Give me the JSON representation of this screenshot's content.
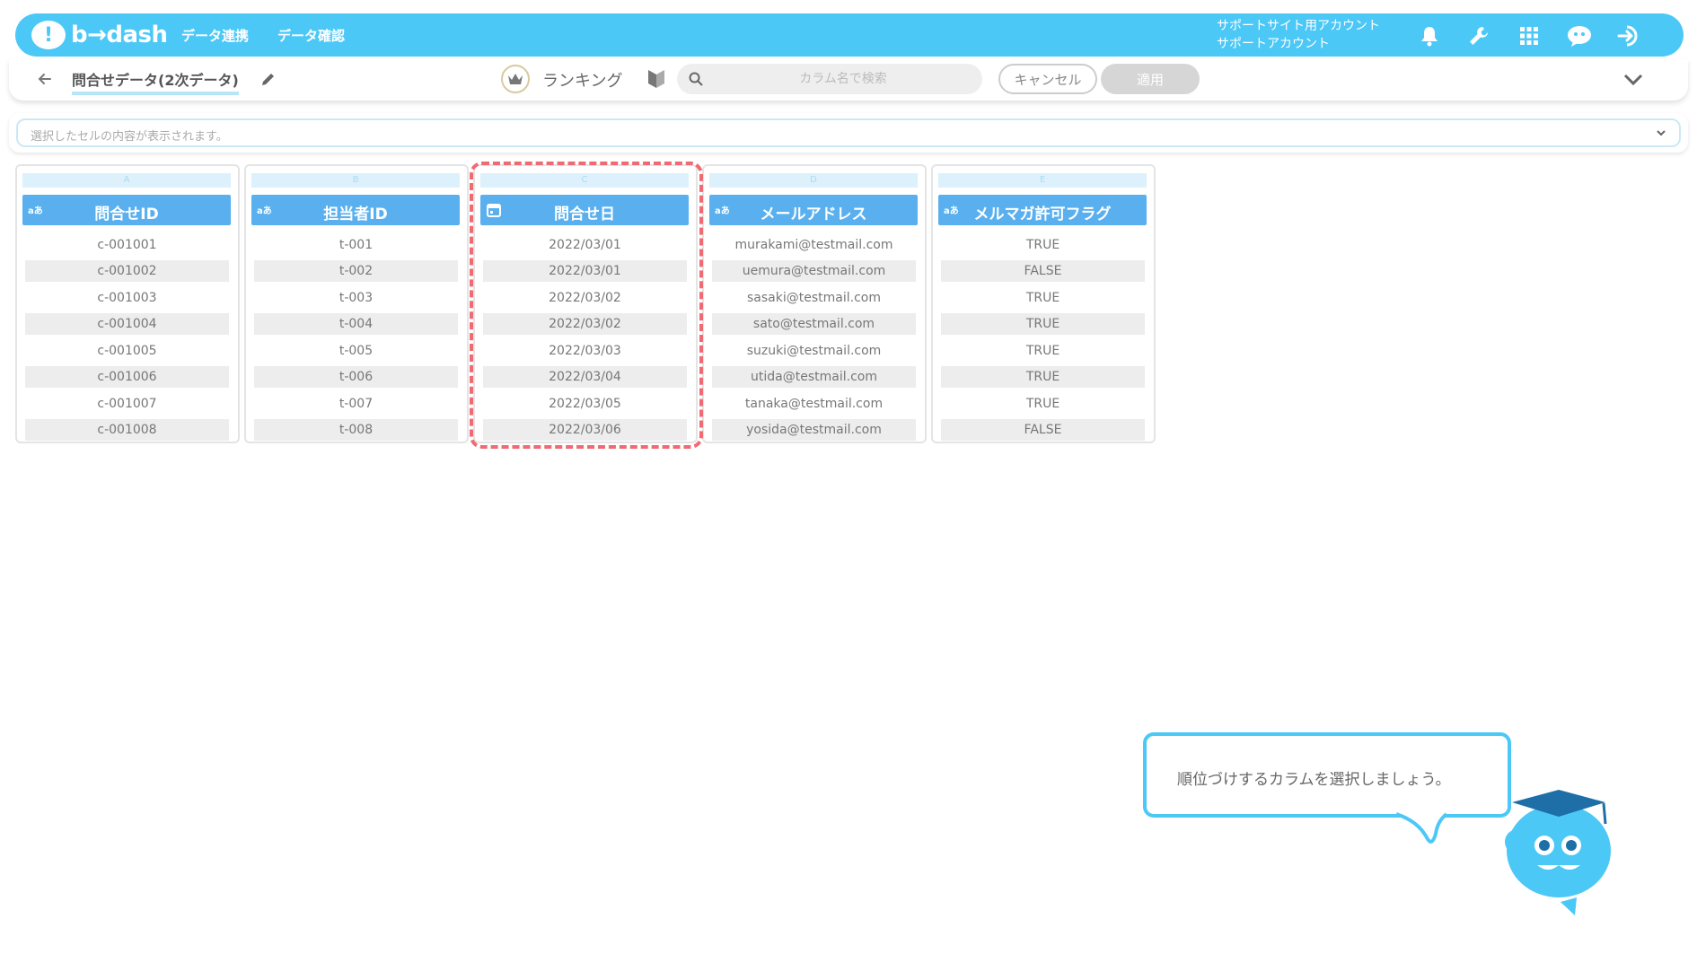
{
  "header": {
    "logo_text": "b→dash",
    "nav": [
      "データ連携",
      "データ確認"
    ],
    "account_line1": "サポートサイト用アカウント",
    "account_line2": "サポートアカウント",
    "icons": [
      "bell-icon",
      "wrench-icon",
      "grid-icon",
      "chat-icon",
      "logout-icon"
    ]
  },
  "subbar": {
    "title": "問合せデータ(2次データ)",
    "ranking_label": "ランキング",
    "search_placeholder": "カラム名で検索",
    "cancel_label": "キャンセル",
    "apply_label": "適用"
  },
  "cellbar": {
    "placeholder": "選択したセルの内容が表示されます。"
  },
  "columns": [
    {
      "letter": "A",
      "type": "aあ",
      "title": "問合せID",
      "cells": [
        "c-001001",
        "c-001002",
        "c-001003",
        "c-001004",
        "c-001005",
        "c-001006",
        "c-001007",
        "c-001008"
      ]
    },
    {
      "letter": "B",
      "type": "aあ",
      "title": "担当者ID",
      "cells": [
        "t-001",
        "t-002",
        "t-003",
        "t-004",
        "t-005",
        "t-006",
        "t-007",
        "t-008"
      ]
    },
    {
      "letter": "C",
      "type": "",
      "title": "問合せ日",
      "cells": [
        "2022/03/01",
        "2022/03/01",
        "2022/03/02",
        "2022/03/02",
        "2022/03/03",
        "2022/03/04",
        "2022/03/05",
        "2022/03/06"
      ]
    },
    {
      "letter": "D",
      "type": "aあ",
      "title": "メールアドレス",
      "cells": [
        "murakami@testmail.com",
        "uemura@testmail.com",
        "sasaki@testmail.com",
        "sato@testmail.com",
        "suzuki@testmail.com",
        "utida@testmail.com",
        "tanaka@testmail.com",
        "yosida@testmail.com"
      ]
    },
    {
      "letter": "E",
      "type": "aあ",
      "title": "メルマガ許可フラグ",
      "cells": [
        "TRUE",
        "FALSE",
        "TRUE",
        "TRUE",
        "TRUE",
        "TRUE",
        "TRUE",
        "FALSE"
      ]
    }
  ],
  "tooltip": {
    "text": "順位づけするカラムを選択しましょう。"
  },
  "colors": {
    "brand": "#4cc8f7",
    "header_col": "#5ab0ee",
    "highlight": "#ef6a72"
  }
}
